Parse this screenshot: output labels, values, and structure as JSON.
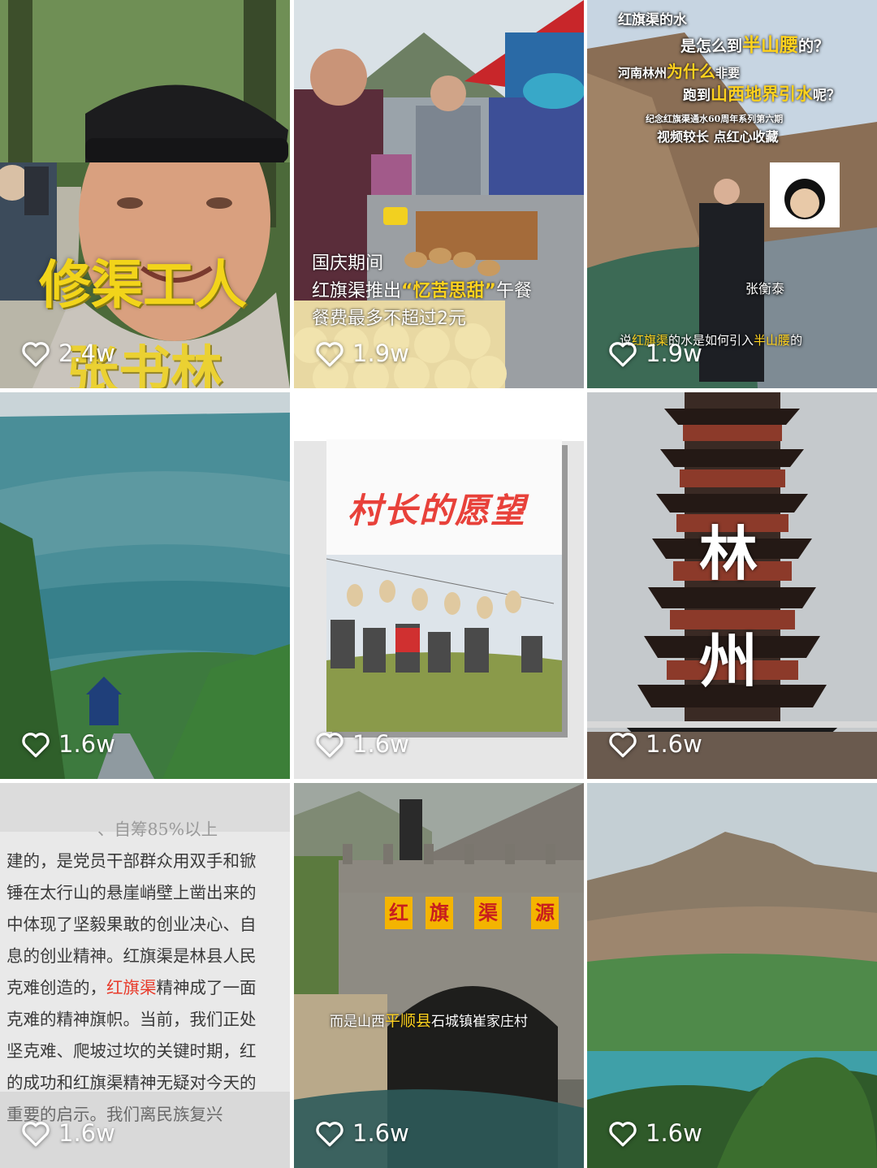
{
  "tiles": [
    {
      "likes": "2.4w",
      "overlay_main": "修渠工人",
      "overlay_sub": "张书林",
      "colors": {
        "overlay": "#f2d41a"
      }
    },
    {
      "likes": "1.9w",
      "line1": "国庆期间",
      "line2_pre": "红旗渠推出",
      "line2_hl": "“忆苦思甜”",
      "line2_post": "午餐",
      "line3": "餐费最多不超过2元",
      "colors": {
        "highlight": "#ffd21e"
      }
    },
    {
      "likes": "1.9w",
      "q1": "红旗渠的水",
      "q2_pre": "是怎么到",
      "q2_hl": "半山腰",
      "q2_post": "的？",
      "q3_pre": "河南林州",
      "q3_hl": "为什么",
      "q3_post": "非要",
      "q4_pre": "跑到",
      "q4_hl": "山西地界引水",
      "q4_post": "呢？",
      "series": "纪念红旗渠通水60周年系列第六期",
      "hint": "视频较长 点红心收藏",
      "speaker": "张衡泰",
      "caption_pre": "说",
      "caption_hl1": "红旗渠",
      "caption_mid": "的水是如何引入",
      "caption_hl2": "半山腰",
      "caption_post": "的"
    },
    {
      "likes": "1.6w"
    },
    {
      "likes": "1.6w",
      "title": "村长的愿望",
      "colors": {
        "title": "#e8413a"
      }
    },
    {
      "likes": "1.6w",
      "char1": "林",
      "char2": "州"
    },
    {
      "likes": "1.6w",
      "text_lines": [
        "、自筹85%以上",
        "建的，是党员干部群众用双手和锨",
        "锤在太行山的悬崖峭壁上凿出来的",
        "中体现了坚毅果敢的创业决心、自",
        "息的创业精神。红旗渠是林县人民",
        "克难创造的，",
        "精神成了一面",
        "克难的精神旗帜。当前，我们正处",
        "坚克难、爬坡过坎的关键时期，红",
        "的成功和红旗渠精神无疑对今天的",
        "重要的启示。我们离民族复兴"
      ],
      "text_highlight": "红旗渠"
    },
    {
      "likes": "1.6w",
      "plaque": [
        "红",
        "旗",
        "渠",
        "源"
      ],
      "subtitle_pre": "而是山西",
      "subtitle_hl": "平顺县",
      "subtitle_post": "石城镇崔家庄村"
    },
    {
      "likes": "1.6w"
    }
  ],
  "icons": {
    "like": "heart-outline-icon"
  }
}
